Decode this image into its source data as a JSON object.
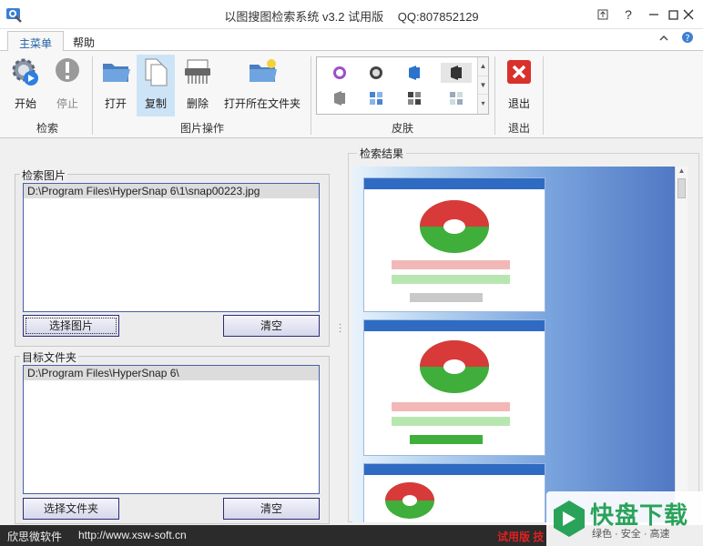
{
  "window": {
    "title": "以图搜图检索系统 v3.2 试用版",
    "qq": "QQ:807852129"
  },
  "ribbon": {
    "tabs": [
      "主菜单",
      "帮助"
    ],
    "groups": {
      "search": {
        "label": "检索",
        "start": "开始",
        "stop": "停止"
      },
      "image_ops": {
        "label": "图片操作",
        "open": "打开",
        "copy": "复制",
        "delete": "删除",
        "open_folder": "打开所在文件夹"
      },
      "skin": {
        "label": "皮肤"
      },
      "exit": {
        "label": "退出",
        "button": "退出"
      }
    }
  },
  "search_image": {
    "title": "检索图片",
    "path": "D:\\Program Files\\HyperSnap 6\\1\\snap00223.jpg",
    "select_button": "选择图片",
    "clear_button": "清空"
  },
  "target_folder": {
    "title": "目标文件夹",
    "path": "D:\\Program Files\\HyperSnap 6\\",
    "select_button": "选择文件夹",
    "clear_button": "清空"
  },
  "results": {
    "title": "检索结果"
  },
  "status": {
    "company": "欣思微软件",
    "url": "http://www.xsw-soft.cn",
    "trial": "试用版 技"
  },
  "watermark": {
    "brand": "快盘下载",
    "slogan": "绿色 · 安全 · 高速"
  },
  "colors": {
    "accent": "#1e5fa7",
    "button_border": "#2c2c7a",
    "trial_text": "#e02020"
  }
}
